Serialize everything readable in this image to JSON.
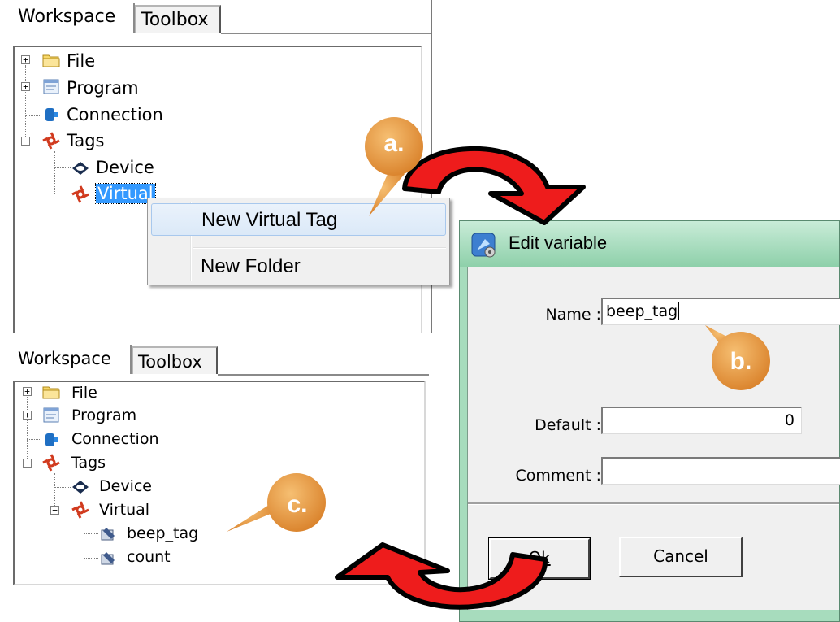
{
  "top_panel": {
    "tabs": [
      {
        "label": "Workspace"
      },
      {
        "label": "Toolbox"
      }
    ],
    "tree": {
      "file": "File",
      "program": "Program",
      "connection": "Connection",
      "tags": "Tags",
      "device": "Device",
      "virtual": "Virtual"
    }
  },
  "context_menu": {
    "items": [
      {
        "label": "New Virtual Tag"
      },
      {
        "label": "New Folder"
      }
    ]
  },
  "bottom_panel": {
    "tabs": [
      {
        "label": "Workspace"
      },
      {
        "label": "Toolbox"
      }
    ],
    "tree": {
      "file": "File",
      "program": "Program",
      "connection": "Connection",
      "tags": "Tags",
      "device": "Device",
      "virtual": "Virtual",
      "children": [
        {
          "label": "beep_tag"
        },
        {
          "label": "count"
        }
      ]
    }
  },
  "dialog": {
    "title": "Edit variable",
    "name_label": "Name :",
    "name_value": "beep_tag",
    "default_label": "Default :",
    "default_value": "0",
    "comment_label": "Comment :",
    "comment_value": "",
    "ok_label": "Ok",
    "cancel_label": "Cancel"
  },
  "callouts": {
    "a": "a.",
    "b": "b.",
    "c": "c."
  },
  "colors": {
    "selection": "#3399ff",
    "callout_orange": "#e89a3c",
    "arrow_red": "#ee1c1c",
    "dialog_frame": "#a7dcbd"
  },
  "icons": [
    "folder-icon",
    "program-icon",
    "connection-icon",
    "tags-icon",
    "device-icon",
    "virtual-icon",
    "tag-item-icon",
    "dialog-app-icon"
  ]
}
